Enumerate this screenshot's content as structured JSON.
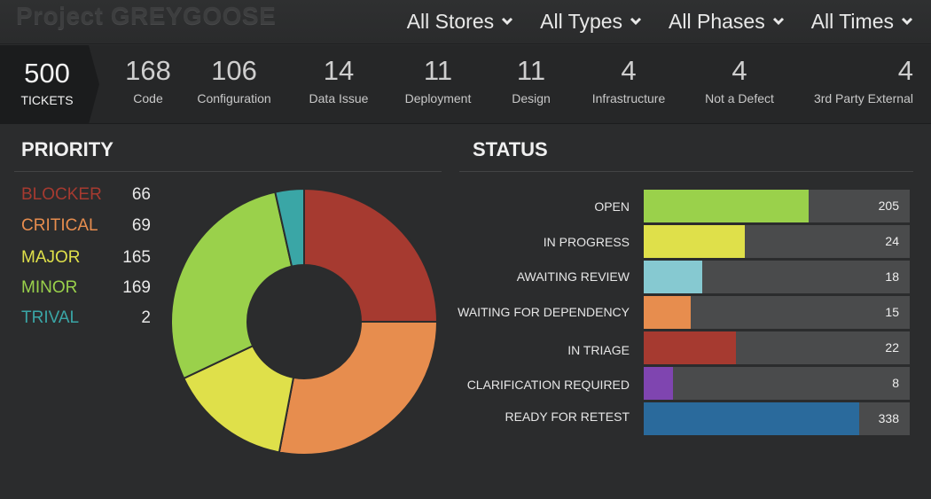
{
  "header": {
    "project_title": "Project GREYGOOSE",
    "filters": [
      {
        "label": "All Stores"
      },
      {
        "label": "All Types"
      },
      {
        "label": "All Phases"
      },
      {
        "label": "All Times"
      }
    ]
  },
  "stats": {
    "total": {
      "value": "500",
      "label": "TICKETS"
    },
    "categories": [
      {
        "value": "168",
        "label": "Code"
      },
      {
        "value": "106",
        "label": "Configuration"
      },
      {
        "value": "14",
        "label": "Data Issue"
      },
      {
        "value": "11",
        "label": "Deployment"
      },
      {
        "value": "11",
        "label": "Design"
      },
      {
        "value": "4",
        "label": "Infrastructure"
      },
      {
        "value": "4",
        "label": "Not a Defect"
      },
      {
        "value": "4",
        "label": "3rd Party External"
      }
    ]
  },
  "priority": {
    "title": "PRIORITY",
    "items": [
      {
        "label": "BLOCKER",
        "value": "66",
        "color": "#a63a30"
      },
      {
        "label": "CRITICAL",
        "value": "69",
        "color": "#e78d4e"
      },
      {
        "label": "MAJOR",
        "value": "165",
        "color": "#dfe04a"
      },
      {
        "label": "MINOR",
        "value": "169",
        "color": "#9ad14b"
      },
      {
        "label": "TRIVAL",
        "value": "2",
        "color": "#3aa6a6"
      }
    ]
  },
  "status": {
    "title": "STATUS",
    "items": [
      {
        "label": "OPEN",
        "value": "205",
        "fraction": 0.62,
        "color": "#9ad14b"
      },
      {
        "label": "IN PROGRESS",
        "value": "24",
        "fraction": 0.38,
        "color": "#dfe04a"
      },
      {
        "label": "AWAITING REVIEW",
        "value": "18",
        "fraction": 0.22,
        "color": "#86c9d1"
      },
      {
        "label": "WAITING FOR DEPENDENCY",
        "value": "15",
        "fraction": 0.175,
        "color": "#e78d4e"
      },
      {
        "label": "IN TRIAGE",
        "value": "22",
        "fraction": 0.347,
        "color": "#a63a30"
      },
      {
        "label": "CLARIFICATION REQUIRED",
        "value": "8",
        "fraction": 0.11,
        "color": "#7f45b0"
      },
      {
        "label": "READY FOR RETEST",
        "value": "338",
        "fraction": 0.81,
        "color": "#2a6a9c"
      }
    ]
  },
  "chart_data": {
    "type": "pie",
    "title": "PRIORITY",
    "categories": [
      "BLOCKER",
      "CRITICAL",
      "MAJOR",
      "MINOR",
      "TRIVAL"
    ],
    "values": [
      66,
      69,
      165,
      169,
      2
    ],
    "colors": [
      "#a63a30",
      "#e78d4e",
      "#dfe04a",
      "#9ad14b",
      "#3aa6a6"
    ],
    "slice_fractions": [
      0.25,
      0.28,
      0.15,
      0.285,
      0.035
    ],
    "donut": true
  }
}
